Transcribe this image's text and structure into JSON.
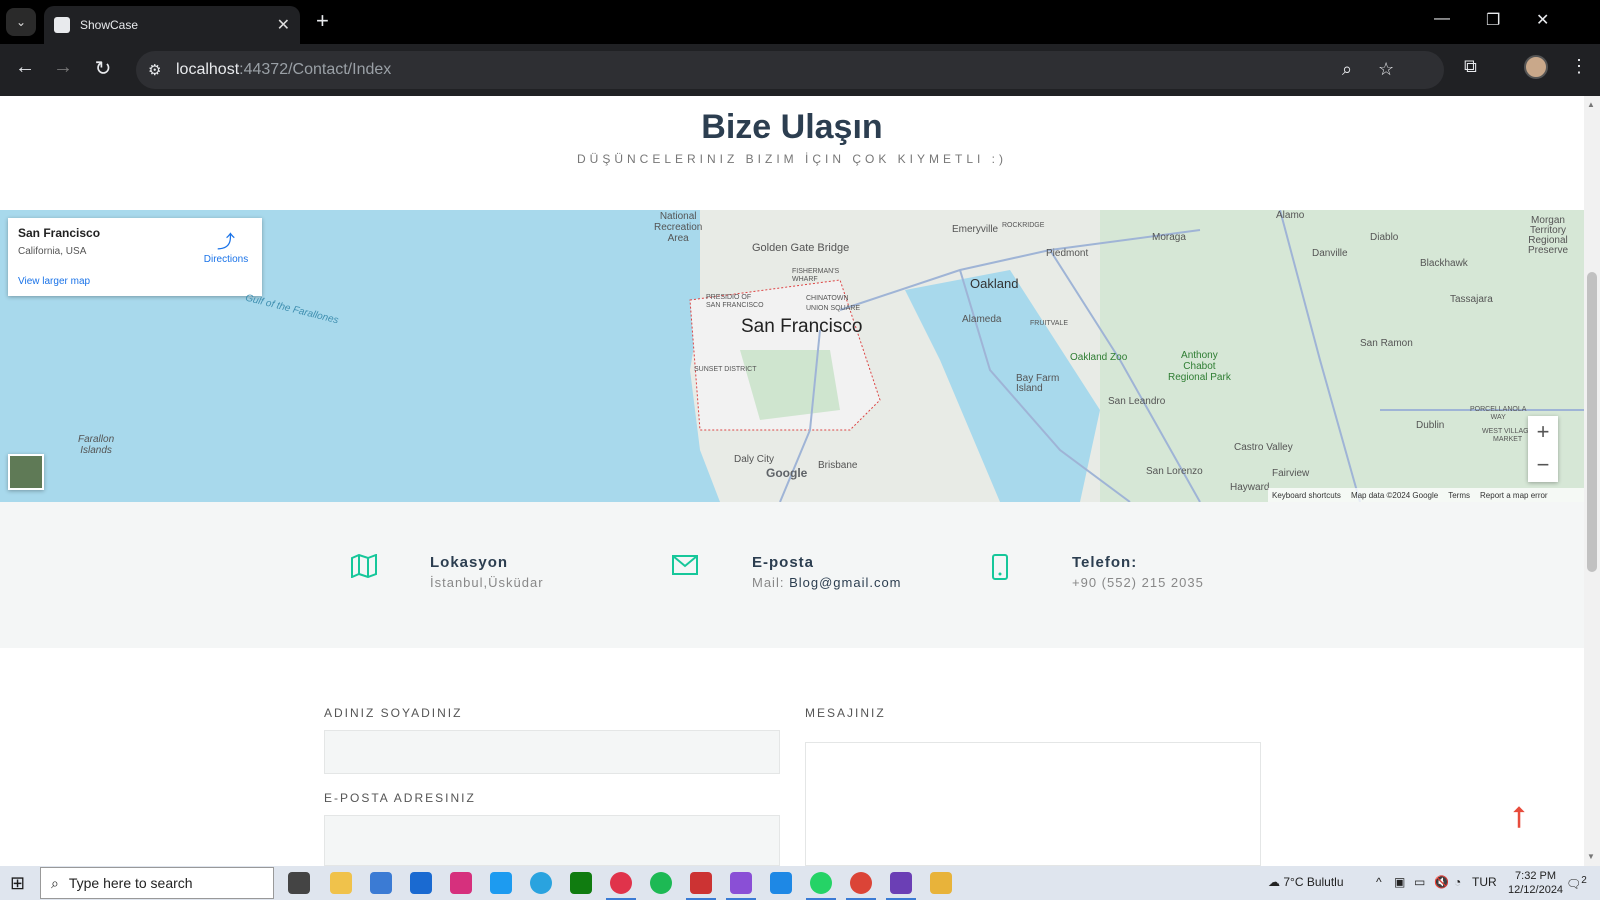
{
  "browser": {
    "tab_title": "ShowCase",
    "url_host": "localhost",
    "url_path": ":44372/Contact/Index"
  },
  "page": {
    "title": "Bize Ulaşın",
    "subtitle": "DÜŞÜNCELERINIZ BIZIM İÇIN ÇOK KIYMETLI :)"
  },
  "map": {
    "place_name": "San Francisco",
    "place_region": "California, USA",
    "directions_label": "Directions",
    "view_larger_label": "View larger map",
    "labels": {
      "city_main": "San Francisco",
      "oakland": "Oakland",
      "golden_gate": "Golden Gate Bridge",
      "national_rec": "National\nRecreation\nArea",
      "fishermans": "FISHERMAN'S\nWHARF",
      "presidio": "PRESIDIO OF\nSAN FRANCISCO",
      "chinatown": "CHINATOWN\nUNION SQUARE",
      "sunset": "SUNSET DISTRICT",
      "emeryville": "Emeryville",
      "rockridge": "ROCKRIDGE",
      "piedmont": "Piedmont",
      "moraga": "Moraga",
      "alamo": "Alamo",
      "danville": "Danville",
      "diablo": "Diablo",
      "blackhawk": "Blackhawk",
      "tassajara": "Tassajara",
      "morgan": "Morgan\nTerritory\nRegional\nPreserve",
      "alameda": "Alameda",
      "fruitvale": "FRUITVALE",
      "oakland_zoo": "Oakland Zoo",
      "anthony_chabot": "Anthony\nChabot\nRegional Park",
      "san_ramon": "San Ramon",
      "bay_farm": "Bay Farm\nIsland",
      "san_leandro": "San Leandro",
      "dublin": "Dublin",
      "porcellanola": "PORCELLANOLA\nWAY",
      "west_village": "WEST VILLAGE\nMARKET",
      "castro_valley": "Castro Valley",
      "san_lorenzo": "San Lorenzo",
      "fairview": "Fairview",
      "hayward": "Hayward",
      "daly_city": "Daly City",
      "brisbane": "Brisbane",
      "farallon": "Farallon\nIslands",
      "gulf": "Gulf of the Farallones"
    },
    "google": "Google",
    "attribution": {
      "keyboard": "Keyboard shortcuts",
      "mapdata": "Map data ©2024 Google",
      "terms": "Terms",
      "report": "Report a map error"
    },
    "zoom_in": "+",
    "zoom_out": "−"
  },
  "contact": {
    "location_label": "Lokasyon",
    "location_value": "İstanbul,Üsküdar",
    "email_label": "E-posta",
    "email_prefix": "Mail: ",
    "email_value": "Blog@gmail.com",
    "phone_label": "Telefon:",
    "phone_value": "+90 (552) 215 2035"
  },
  "form": {
    "name_label": "ADINIZ SOYADINIZ",
    "email_label": "E-POSTA ADRESINIZ",
    "message_label": "MESAJINIZ"
  },
  "taskbar": {
    "search_placeholder": "Type here to search",
    "weather": "7°C  Bulutlu",
    "lang": "TUR",
    "time": "7:32 PM",
    "date": "12/12/2024",
    "notif_count": "2"
  },
  "colors": {
    "accent": "#16c79a",
    "heading": "#2c3e50",
    "to_top": "#e74c3c"
  }
}
